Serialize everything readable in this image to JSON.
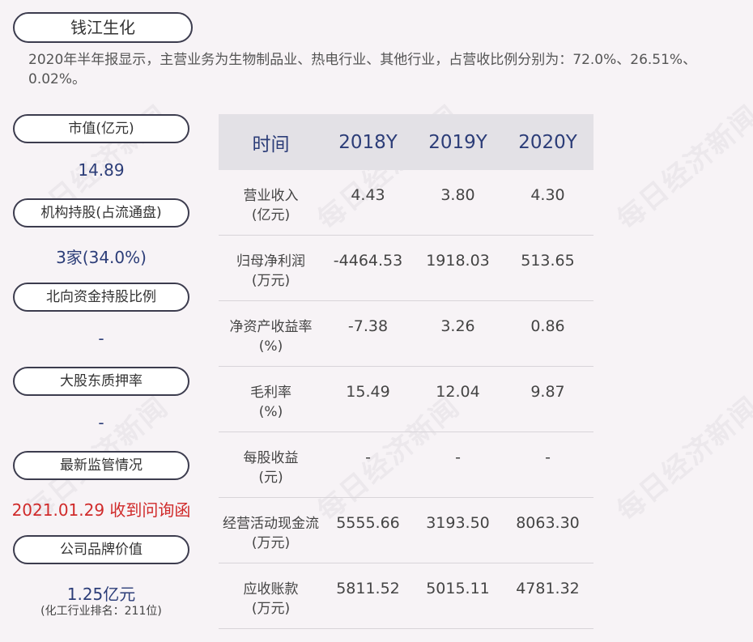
{
  "watermark": "每日经济新闻",
  "company": "钱江生化",
  "summary": "2020年半年报显示，主营业务为生物制品业、热电行业、其他行业，占营收比例分别为：72.0%、26.51%、0.02%。",
  "left": {
    "market_cap_label": "市值(亿元)",
    "market_cap_value": "14.89",
    "institution_label": "机构持股(占流通盘)",
    "institution_value": "3家(34.0%)",
    "northbound_label": "北向资金持股比例",
    "northbound_value": "-",
    "pledge_label": "大股东质押率",
    "pledge_value": "-",
    "regulation_label": "最新监管情况",
    "regulation_value": "2021.01.29 收到问询函",
    "brand_label": "公司品牌价值",
    "brand_value": "1.25亿元",
    "brand_note": "(化工行业排名：211位)"
  },
  "table": {
    "headers": [
      "时间",
      "2018Y",
      "2019Y",
      "2020Y"
    ],
    "rows": [
      {
        "label1": "营业收入",
        "label2": "(亿元)",
        "values": [
          "4.43",
          "3.80",
          "4.30"
        ]
      },
      {
        "label1": "归母净利润",
        "label2": "(万元)",
        "values": [
          "-4464.53",
          "1918.03",
          "513.65"
        ]
      },
      {
        "label1": "净资产收益率",
        "label2": "(%)",
        "values": [
          "-7.38",
          "3.26",
          "0.86"
        ]
      },
      {
        "label1": "毛利率",
        "label2": "(%)",
        "values": [
          "15.49",
          "12.04",
          "9.87"
        ]
      },
      {
        "label1": "每股收益",
        "label2": "(元)",
        "values": [
          "-",
          "-",
          "-"
        ]
      },
      {
        "label1": "经营活动现金流",
        "label2": "(万元)",
        "values": [
          "5555.66",
          "3193.50",
          "8063.30"
        ]
      },
      {
        "label1": "应收账款",
        "label2": "(万元)",
        "values": [
          "5811.52",
          "5015.11",
          "4781.32"
        ]
      }
    ]
  }
}
